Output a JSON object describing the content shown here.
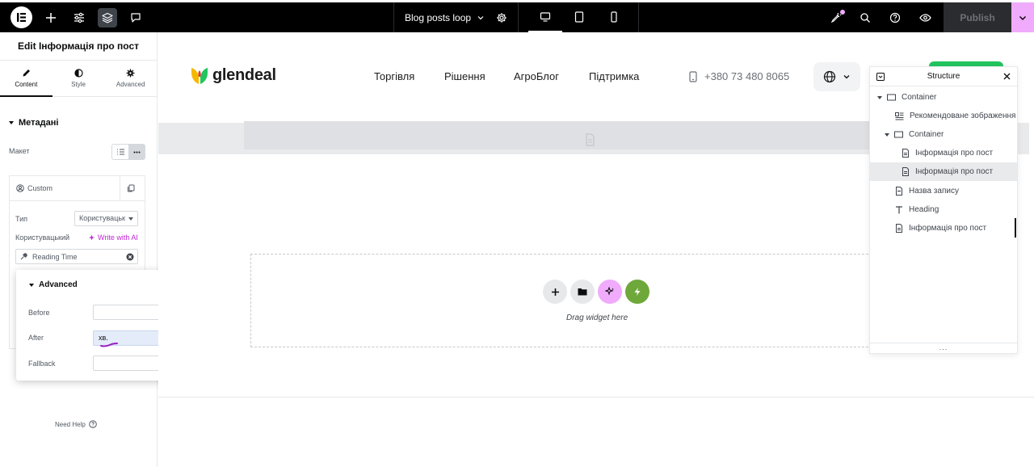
{
  "topbar": {
    "page_title": "Blog posts loop",
    "publish_label": "Publish",
    "colors": {
      "background": "#000000",
      "accent": "#f0abfc"
    }
  },
  "panel": {
    "title": "Edit Інформація про пост",
    "tabs": [
      {
        "label": "Content",
        "icon": "pencil-icon"
      },
      {
        "label": "Style",
        "icon": "half-circle-icon"
      },
      {
        "label": "Advanced",
        "icon": "gear-icon"
      }
    ],
    "section_title": "Метадані",
    "layout_label": "Макет",
    "custom_label": "Custom",
    "type_label": "Тип",
    "type_value": "Користувацьк",
    "custom_field_label": "Користувацький",
    "write_ai_label": "Write with AI",
    "dynamic_value": "Reading Time",
    "need_help": "Need Help"
  },
  "advanced_popover": {
    "title": "Advanced",
    "before_label": "Before",
    "before_value": "",
    "after_label": "After",
    "after_value": "хв.",
    "fallback_label": "Fallback",
    "fallback_value": ""
  },
  "site": {
    "logo_text": "glendeal",
    "nav": [
      "Торгівля",
      "Рішення",
      "АгроБлог",
      "Підтримка"
    ],
    "phone": "+380 73 480 8065",
    "brand_colors": {
      "green": "#22c55e",
      "yellow": "#f5b800"
    }
  },
  "canvas": {
    "drop_text": "Drag widget here"
  },
  "structure": {
    "title": "Structure",
    "items": [
      {
        "label": "Container",
        "icon": "container-icon"
      },
      {
        "label": "Рекомендоване зображення",
        "icon": "image-icon"
      },
      {
        "label": "Container",
        "icon": "container-icon"
      },
      {
        "label": "Інформація про пост",
        "icon": "post-info-icon"
      },
      {
        "label": "Інформація про пост",
        "icon": "post-info-icon"
      },
      {
        "label": "Назва запису",
        "icon": "post-title-icon"
      },
      {
        "label": "Heading",
        "icon": "heading-icon"
      },
      {
        "label": "Інформація про пост",
        "icon": "post-info-icon"
      }
    ],
    "footer": "..."
  }
}
